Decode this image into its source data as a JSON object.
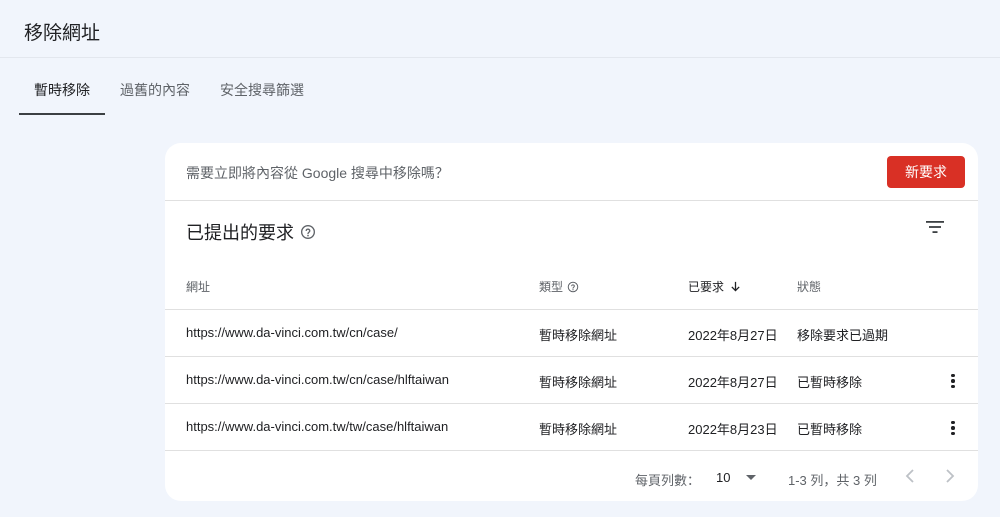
{
  "page": {
    "title": "移除網址"
  },
  "tabs": [
    {
      "label": "暫時移除",
      "active": true
    },
    {
      "label": "過舊的內容",
      "active": false
    },
    {
      "label": "安全搜尋篩選",
      "active": false
    }
  ],
  "card": {
    "prompt": "需要立即將內容從 Google 搜尋中移除嗎？",
    "new_request_label": "新要求",
    "section_title": "已提出的要求",
    "columns": {
      "url": "網址",
      "type": "類型",
      "requested": "已要求",
      "status": "狀態"
    },
    "rows": [
      {
        "url": "https://www.da-vinci.com.tw/cn/case/",
        "type": "暫時移除網址",
        "date": "2022年8月27日",
        "status": "移除要求已過期",
        "has_menu": false
      },
      {
        "url": "https://www.da-vinci.com.tw/cn/case/hlftaiwan",
        "type": "暫時移除網址",
        "date": "2022年8月27日",
        "status": "已暫時移除",
        "has_menu": true
      },
      {
        "url": "https://www.da-vinci.com.tw/tw/case/hlftaiwan",
        "type": "暫時移除網址",
        "date": "2022年8月23日",
        "status": "已暫時移除",
        "has_menu": true
      }
    ],
    "pagination": {
      "rows_per_page_label": "每頁列數：",
      "rows_per_page_value": "10",
      "range": "1-3 列，共 3 列"
    }
  },
  "colors": {
    "accent_red": "#d93025",
    "background": "#f1f5fc"
  },
  "icons": {
    "help": "help-circle-icon",
    "filter": "filter-list-icon",
    "sort": "arrow-down-icon",
    "more": "more-vert-icon",
    "prev": "chevron-left-icon",
    "next": "chevron-right-icon"
  }
}
